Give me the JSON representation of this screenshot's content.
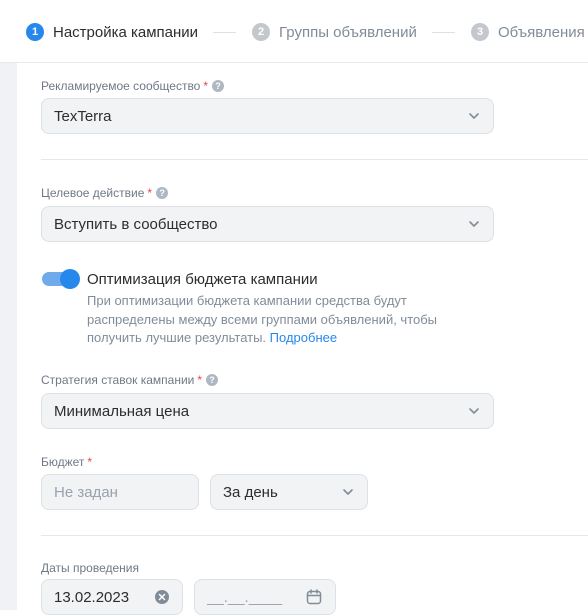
{
  "stepper": {
    "steps": [
      {
        "num": "1",
        "label": "Настройка кампании",
        "active": true
      },
      {
        "num": "2",
        "label": "Группы объявлений",
        "active": false
      },
      {
        "num": "3",
        "label": "Объявления",
        "active": false
      }
    ]
  },
  "community": {
    "label": "Рекламируемое сообщество",
    "required_mark": "*",
    "help_glyph": "?",
    "value": "TexTerra"
  },
  "target_action": {
    "label": "Целевое действие",
    "required_mark": "*",
    "help_glyph": "?",
    "value": "Вступить в сообщество"
  },
  "budget_optimization": {
    "enabled": true,
    "title": "Оптимизация бюджета кампании",
    "description": "При оптимизации бюджета кампании средства будут распределены между всеми группами объявлений, чтобы получить лучшие результаты.",
    "link": "Подробнее"
  },
  "bid_strategy": {
    "label": "Стратегия ставок кампании",
    "required_mark": "*",
    "help_glyph": "?",
    "value": "Минимальная цена"
  },
  "budget": {
    "label": "Бюджет",
    "required_mark": "*",
    "amount_placeholder": "Не задан",
    "period_value": "За день"
  },
  "dates": {
    "label": "Даты проведения",
    "start_value": "13.02.2023",
    "end_placeholder": "__.__.____"
  },
  "colors": {
    "accent": "#2688eb",
    "inactive_step": "#c4c8cc",
    "required": "#e64646"
  },
  "icons": {
    "dropdown": "chevron-down-icon",
    "clear": "clear-icon",
    "calendar": "calendar-icon",
    "help": "help-icon"
  }
}
